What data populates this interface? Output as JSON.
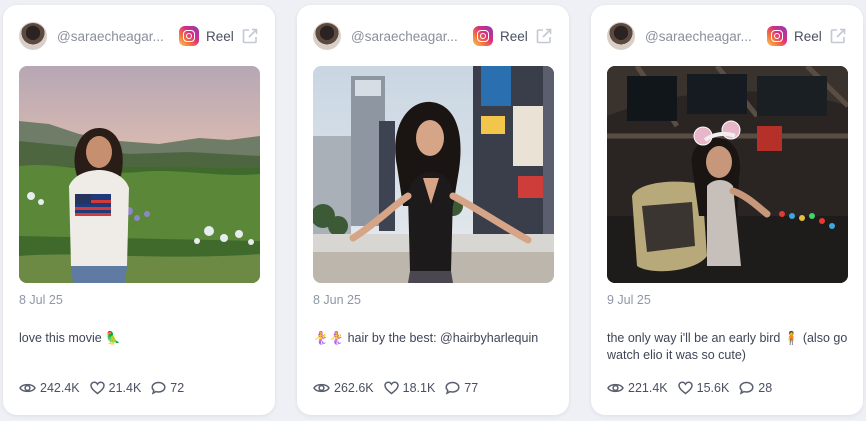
{
  "posts": [
    {
      "handle": "@saraecheagar...",
      "type": "Reel",
      "date": "8 Jul 25",
      "caption": "love this movie 🦜",
      "views": "242.4K",
      "likes": "21.4K",
      "comments": "72"
    },
    {
      "handle": "@saraecheagar...",
      "type": "Reel",
      "date": "8 Jun 25",
      "caption": "🧜‍♀️🧜‍♀️ hair by the best: @hairbyharlequin",
      "views": "262.6K",
      "likes": "18.1K",
      "comments": "77"
    },
    {
      "handle": "@saraecheagar...",
      "type": "Reel",
      "date": "9 Jul 25",
      "caption": "the only way i'll be an early bird 🧍 (also go watch elio it was so cute)",
      "views": "221.4K",
      "likes": "15.6K",
      "comments": "28"
    }
  ],
  "icons": {
    "platform": "instagram-icon",
    "external": "external-link-icon",
    "views": "eye-icon",
    "likes": "heart-icon",
    "comments": "comment-icon"
  },
  "colors": {
    "background": "#eef0f5",
    "card": "#ffffff",
    "muted_text": "#8f96a5",
    "body_text": "#3f4556"
  }
}
